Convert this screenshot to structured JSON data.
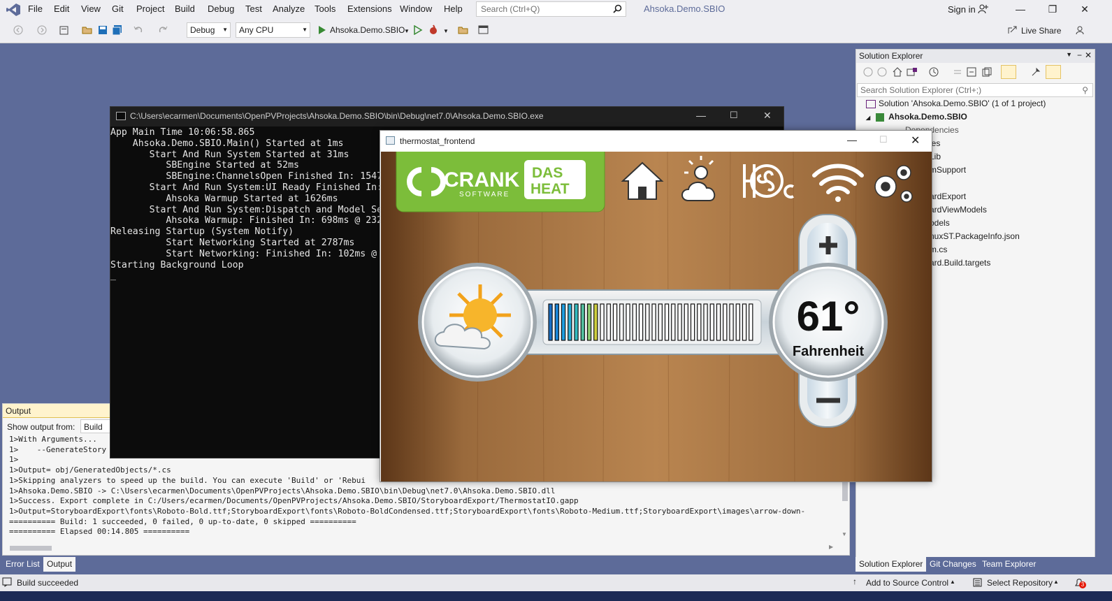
{
  "menubar": {
    "items": [
      "File",
      "Edit",
      "View",
      "Git",
      "Project",
      "Build",
      "Debug",
      "Test",
      "Analyze",
      "Tools",
      "Extensions",
      "Window",
      "Help"
    ],
    "search_placeholder": "Search (Ctrl+Q)",
    "solution_title": "Ahsoka.Demo.SBIO",
    "sign_in": "Sign in"
  },
  "toolbar": {
    "configuration": "Debug",
    "platform": "Any CPU",
    "start_target": "Ahsoka.Demo.SBIO",
    "live_share": "Live Share"
  },
  "solution_explorer": {
    "title": "Solution Explorer",
    "search_placeholder": "Search Solution Explorer (Ctrl+;)",
    "tree": [
      "Solution 'Ahsoka.Demo.SBIO' (1 of 1 project)",
      "Ahsoka.Demo.SBIO",
      "Dependencies",
      "ies",
      "Lib",
      "mSupport",
      "ardExport",
      "ardViewModels",
      "odels",
      "nuxST.PackageInfo.json",
      "m.cs",
      "ard.Build.targets"
    ],
    "tabs": [
      "Solution Explorer",
      "Git Changes",
      "Team Explorer"
    ]
  },
  "output": {
    "title": "Output",
    "show_from_label": "Show output from:",
    "show_from_value": "Build",
    "lines": [
      "1>With Arguments...",
      "1>    --GenerateStory",
      "1>",
      "1>Output= obj/GeneratedObjects/*.cs",
      "1>Skipping analyzers to speed up the build. You can execute 'Build' or 'Rebui",
      "1>Ahsoka.Demo.SBIO -> C:\\Users\\ecarmen\\Documents\\OpenPVProjects\\Ahsoka.Demo.SBIO\\bin\\Debug\\net7.0\\Ahsoka.Demo.SBIO.dll",
      "1>Success. Export complete in C:/Users/ecarmen/Documents/OpenPVProjects/Ahsoka.Demo.SBIO/StoryboardExport/ThermostatIO.gapp",
      "1>Output=StoryboardExport\\fonts\\Roboto-Bold.ttf;StoryboardExport\\fonts\\Roboto-BoldCondensed.ttf;StoryboardExport\\fonts\\Roboto-Medium.ttf;StoryboardExport\\images\\arrow-down-",
      "========== Build: 1 succeeded, 0 failed, 0 up-to-date, 0 skipped ==========",
      "========== Elapsed 00:14.805 =========="
    ],
    "tabs": [
      "Error List",
      "Output"
    ]
  },
  "statusbar": {
    "build_status": "Build succeeded",
    "add_to_source": "Add to Source Control",
    "select_repo": "Select Repository",
    "notifications": "3"
  },
  "console": {
    "title": "C:\\Users\\ecarmen\\Documents\\OpenPVProjects\\Ahsoka.Demo.SBIO\\bin\\Debug\\net7.0\\Ahsoka.Demo.SBIO.exe",
    "lines": [
      "App Main Time 10:06:58.865",
      "    Ahsoka.Demo.SBIO.Main() Started at 1ms",
      "       Start And Run System Started at 31ms",
      "          SBEngine Started at 52ms",
      "          SBEngine:ChannelsOpen Finished In: 1547",
      "       Start And Run System:UI Ready Finished In:",
      "          Ahsoka Warmup Started at 1626ms",
      "       Start And Run System:Dispatch and Model Se",
      "          Ahsoka Warmup: Finished In: 698ms @ 232",
      "Releasing Startup (System Notify)",
      "          Start Networking Started at 2787ms",
      "          Start Networking: Finished In: 102ms @",
      "Starting Background Loop",
      "_"
    ]
  },
  "thermostat": {
    "title": "thermostat_frontend",
    "logo_text": "CRANK",
    "logo_sub": "SOFTWARE",
    "badge_line1": "DAS",
    "badge_line2": "HEAT",
    "temperature": "61°",
    "unit": "Fahrenheit",
    "level_bars": 32,
    "level_colored": 8,
    "colors": {
      "wood": "#8a5a2e",
      "logo_green": "#7cbd3a",
      "bar_cold": "#1e8ee0",
      "bar_warm": "#d8d040"
    }
  }
}
